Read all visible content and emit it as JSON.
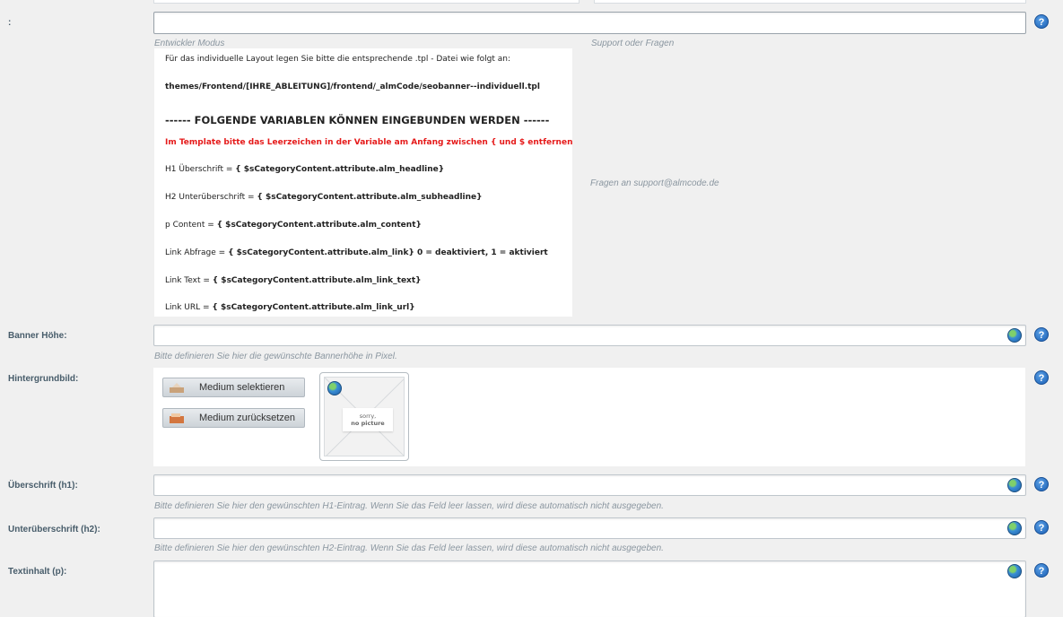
{
  "developer_row": {
    "label": ":",
    "hint_left": "Entwickler Modus",
    "hint_right": "Support oder Fragen",
    "support_text": "Fragen an support@almcode.de",
    "help_icon": "?"
  },
  "info": {
    "line1": "Für das individuelle Layout legen Sie bitte die entsprechende .tpl - Datei wie folgt an:",
    "path": "themes/Frontend/[IHRE_ABLEITUNG]/frontend/_almCode/seobanner--individuell.tpl",
    "heading": "------ FOLGENDE VARIABLEN KÖNNEN EINGEBUNDEN WERDEN ------",
    "warning": "Im Template bitte das Leerzeichen in der Variable am Anfang zwischen { und $ entfernen!",
    "vars": [
      {
        "prefix": "H1 Überschrift = ",
        "code": "{ $sCategoryContent.attribute.alm_headline}"
      },
      {
        "prefix": "H2 Unterüberschrift = ",
        "code": "{ $sCategoryContent.attribute.alm_subheadline}"
      },
      {
        "prefix": "p Content = ",
        "code": "{ $sCategoryContent.attribute.alm_content}"
      },
      {
        "prefix": "Link Abfrage = ",
        "code": "{ $sCategoryContent.attribute.alm_link} 0 = deaktiviert, 1 = aktiviert"
      },
      {
        "prefix": "Link Text = ",
        "code": "{ $sCategoryContent.attribute.alm_link_text}"
      },
      {
        "prefix": "Link URL = ",
        "code": "{ $sCategoryContent.attribute.alm_link_url}"
      }
    ]
  },
  "banner_height": {
    "label": "Banner Höhe:",
    "value": "",
    "hint": "Bitte definieren Sie hier die gewünschte Bannerhöhe in Pixel."
  },
  "background": {
    "label": "Hintergrundbild:",
    "select_button": "Medium selektieren",
    "reset_button": "Medium zurücksetzen",
    "no_picture_line1": "sorry,",
    "no_picture_line2": "no picture"
  },
  "h1": {
    "label": "Überschrift (h1):",
    "value": "",
    "hint": "Bitte definieren Sie hier den gewünschten H1-Eintrag. Wenn Sie das Feld leer lassen, wird diese automatisch nicht ausgegeben."
  },
  "h2": {
    "label": "Unterüberschrift (h2):",
    "value": "",
    "hint": "Bitte definieren Sie hier den gewünschten H2-Eintrag. Wenn Sie das Feld leer lassen, wird diese automatisch nicht ausgegeben."
  },
  "p": {
    "label": "Textinhalt (p):",
    "value": ""
  },
  "colors": {
    "help_blue": "#1a5fb4",
    "warning_red": "#e51a1a",
    "label_text": "#475c6a",
    "hint_text": "#8a96a0"
  }
}
